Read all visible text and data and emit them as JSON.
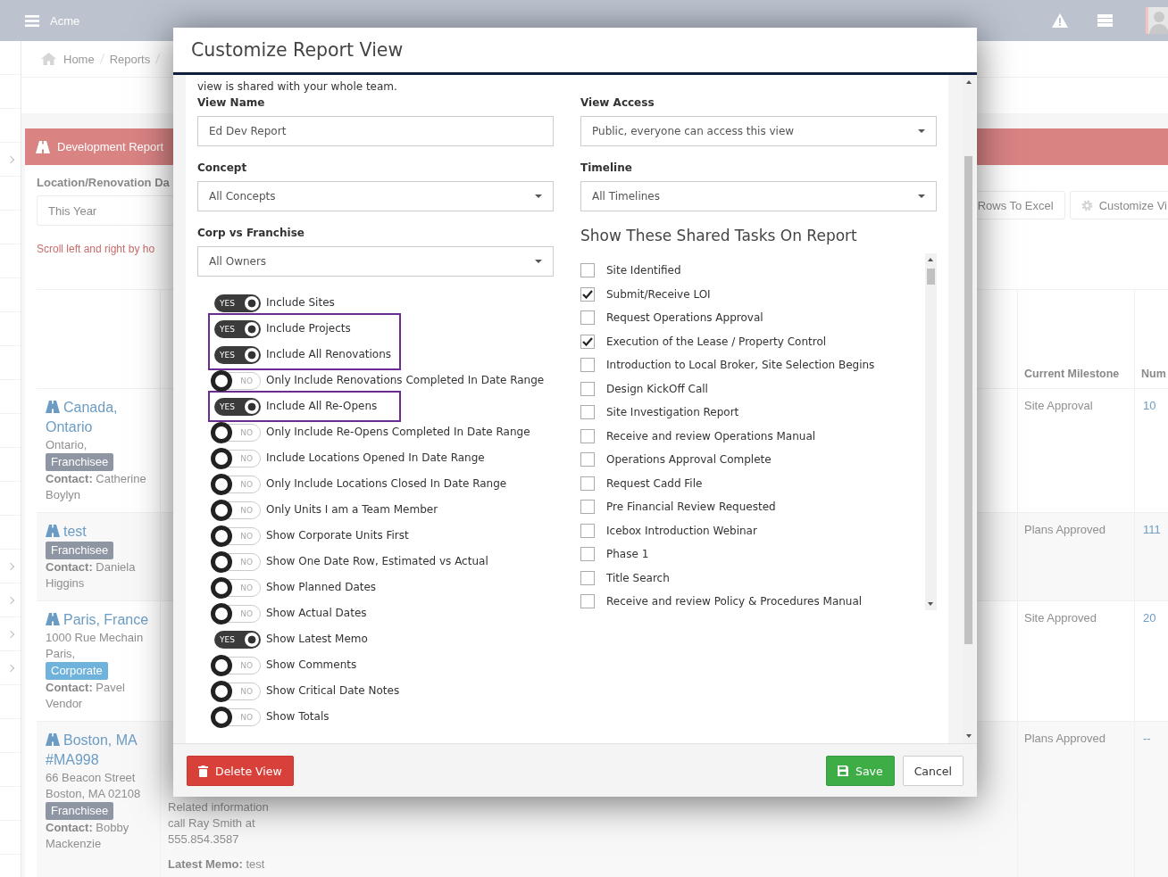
{
  "topbar": {
    "brand": "Acme"
  },
  "breadcrumbs": [
    "Home",
    "Reports"
  ],
  "panel": {
    "title": "Development Report",
    "filter_label": "Location/Renovation Da",
    "filter_value": "This Year",
    "hint": "Scroll left and right by ho",
    "toolbar_buttons": [
      "Rows To Excel",
      "Customize Vi"
    ]
  },
  "table": {
    "columns": [
      {
        "label": "Current Milestone"
      },
      {
        "label": "Num"
      }
    ],
    "rows": [
      {
        "name": "Canada, Ontario",
        "address": [
          "Ontario,"
        ],
        "badge": "Franchisee",
        "kind": "franchisee",
        "contact": "**Contact:** Catherine Boylyn",
        "milestone": "Site Approval",
        "number": "10"
      },
      {
        "name": "test",
        "badge": "Franchisee",
        "kind": "franchisee",
        "contact": "**Contact:** Daniela Higgins",
        "milestone": "Plans Approved",
        "number": "111"
      },
      {
        "name": "Paris, France",
        "address": [
          "1000 Rue Mechain",
          "Paris,"
        ],
        "badge": "Corporate",
        "kind": "corporate",
        "contact": "**Contact:** Pavel Vendor",
        "milestone": "Site Approved",
        "number": "20"
      },
      {
        "name": "Boston, MA #MA998",
        "address": [
          "66 Beacon Street",
          "Boston, MA 02108"
        ],
        "badge": "Franchisee",
        "kind": "franchisee",
        "contact": "**Contact:** Bobby Mackenzie",
        "notes": [
          "Related information",
          "call Ray Smith at",
          "555.854.3587"
        ],
        "memo": "**Latest Memo:** test",
        "milestone": "Plans Approved",
        "number": "--"
      }
    ]
  },
  "modal": {
    "title": "Customize Report View",
    "intro": "view is shared with your whole team.",
    "left_fields": [
      {
        "label": "View Name",
        "kind": "text",
        "value": "Ed Dev Report"
      },
      {
        "label": "Concept",
        "kind": "select",
        "value": "All Concepts"
      },
      {
        "label": "Corp vs Franchise",
        "kind": "select",
        "value": "All Owners"
      }
    ],
    "right_fields": [
      {
        "label": "View Access",
        "kind": "select",
        "value": "Public, everyone can access this view"
      },
      {
        "label": "Timeline",
        "kind": "select",
        "value": "All Timelines"
      }
    ],
    "toggles": [
      {
        "label": "Include Sites",
        "on": true,
        "switch_text": "YES",
        "highlighted": false
      },
      {
        "label": "Include Projects",
        "on": true,
        "switch_text": "YES",
        "highlighted": true
      },
      {
        "label": "Include All Renovations",
        "on": true,
        "switch_text": "YES",
        "highlighted": true
      },
      {
        "label": "Only Include Renovations Completed In Date Range",
        "on": false,
        "switch_text": "NO",
        "highlighted": false
      },
      {
        "label": "Include All Re-Opens",
        "on": true,
        "switch_text": "YES",
        "highlighted": true
      },
      {
        "label": "Only Include Re-Opens Completed In Date Range",
        "on": false,
        "switch_text": "NO",
        "highlighted": false
      },
      {
        "label": "Include Locations Opened In Date Range",
        "on": false,
        "switch_text": "NO",
        "highlighted": false
      },
      {
        "label": "Only Include Locations Closed In Date Range",
        "on": false,
        "switch_text": "NO",
        "highlighted": false
      },
      {
        "label": "Only Units I am a Team Member",
        "on": false,
        "switch_text": "NO",
        "highlighted": false
      },
      {
        "label": "Show Corporate Units First",
        "on": false,
        "switch_text": "NO",
        "highlighted": false
      },
      {
        "label": "Show One Date Row, Estimated vs Actual",
        "on": false,
        "switch_text": "NO",
        "highlighted": false
      },
      {
        "label": "Show Planned Dates",
        "on": false,
        "switch_text": "NO",
        "highlighted": false
      },
      {
        "label": "Show Actual Dates",
        "on": false,
        "switch_text": "NO",
        "highlighted": false
      },
      {
        "label": "Show Latest Memo",
        "on": true,
        "switch_text": "YES",
        "highlighted": false
      },
      {
        "label": "Show Comments",
        "on": false,
        "switch_text": "NO",
        "highlighted": false
      },
      {
        "label": "Show Critical Date Notes",
        "on": false,
        "switch_text": "NO",
        "highlighted": false
      },
      {
        "label": "Show Totals",
        "on": false,
        "switch_text": "NO",
        "highlighted": false
      }
    ],
    "tasks_title": "Show These Shared Tasks On Report",
    "tasks": [
      {
        "label": "Site Identified",
        "checked": false
      },
      {
        "label": "Submit/Receive LOI",
        "checked": true
      },
      {
        "label": "Request Operations Approval",
        "checked": false
      },
      {
        "label": "Execution of the Lease / Property Control",
        "checked": true
      },
      {
        "label": "Introduction to Local Broker, Site Selection Begins",
        "checked": false
      },
      {
        "label": "Design KickOff Call",
        "checked": false
      },
      {
        "label": "Site Investigation Report",
        "checked": false
      },
      {
        "label": "Receive and review Operations Manual",
        "checked": false
      },
      {
        "label": "Operations Approval Complete",
        "checked": false
      },
      {
        "label": "Request Cadd File",
        "checked": false
      },
      {
        "label": "Pre Financial Review Requested",
        "checked": false
      },
      {
        "label": "Icebox Introduction Webinar",
        "checked": false
      },
      {
        "label": "Phase 1",
        "checked": false
      },
      {
        "label": "Title Search",
        "checked": false
      },
      {
        "label": "Receive and review Policy & Procedures Manual",
        "checked": false
      }
    ],
    "buttons": {
      "delete": "Delete View",
      "save": "Save",
      "cancel": "Cancel"
    }
  }
}
